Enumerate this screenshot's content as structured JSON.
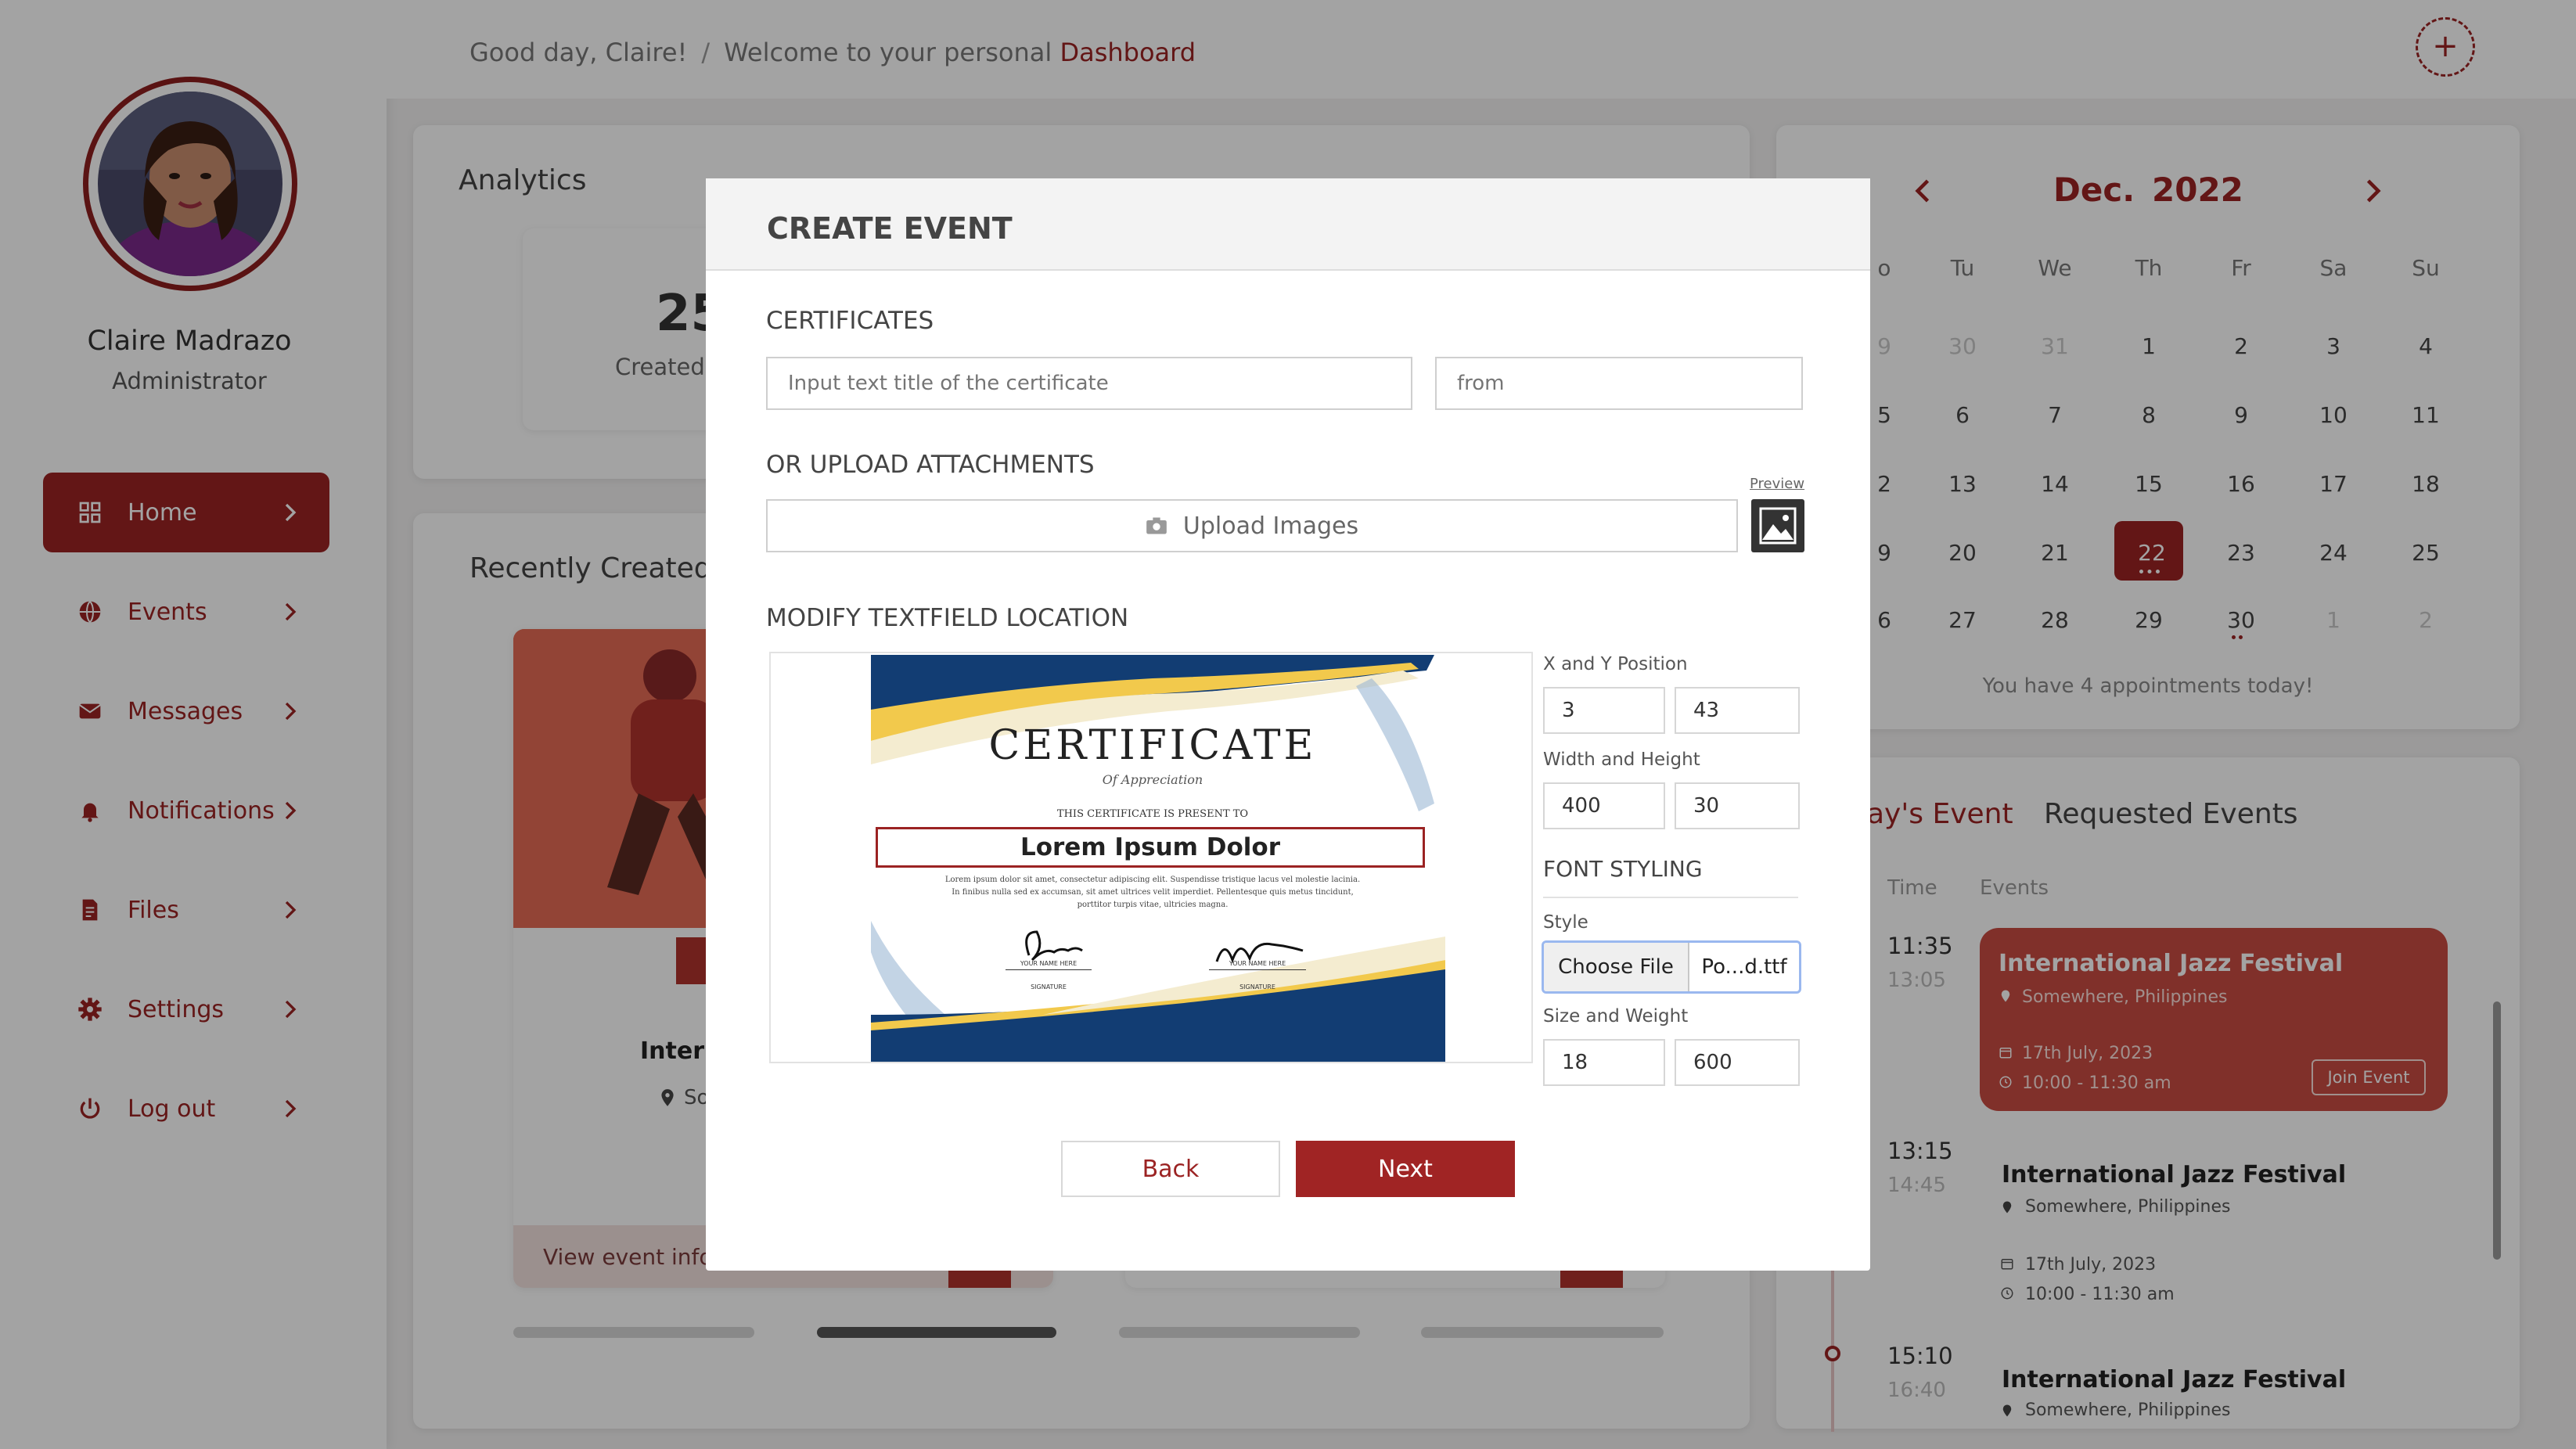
{
  "sidebar": {
    "user_name": "Claire Madrazo",
    "user_role": "Administrator",
    "items": [
      {
        "label": "Home",
        "icon": "grid-icon"
      },
      {
        "label": "Events",
        "icon": "globe-icon"
      },
      {
        "label": "Messages",
        "icon": "envelope-icon"
      },
      {
        "label": "Notifications",
        "icon": "bell-icon"
      },
      {
        "label": "Files",
        "icon": "file-icon"
      },
      {
        "label": "Settings",
        "icon": "gear-icon"
      },
      {
        "label": "Log out",
        "icon": "power-icon"
      }
    ]
  },
  "header": {
    "greeting": "Good day, Claire!",
    "separator": "/",
    "welcome": "Welcome to your personal",
    "highlight": "Dashboard",
    "add_symbol": "+"
  },
  "analytics": {
    "title": "Analytics",
    "stat_value": "25",
    "stat_label": "Created"
  },
  "recent": {
    "title": "Recently Created",
    "card_name": "Intern",
    "card_location_short": "So",
    "card_link": "View event inform"
  },
  "calendar": {
    "month": "Dec.",
    "year": "2022",
    "weekdays": [
      "o",
      "Tu",
      "We",
      "Th",
      "Fr",
      "Sa",
      "Su"
    ],
    "weeks": [
      [
        "9",
        "30",
        "31",
        "1",
        "2",
        "3",
        "4"
      ],
      [
        "5",
        "6",
        "7",
        "8",
        "9",
        "10",
        "11"
      ],
      [
        "2",
        "13",
        "14",
        "15",
        "16",
        "17",
        "18"
      ],
      [
        "9",
        "20",
        "21",
        "22",
        "23",
        "24",
        "25"
      ],
      [
        "6",
        "27",
        "28",
        "29",
        "30",
        "1",
        "2"
      ]
    ],
    "today": "22",
    "appointments": "You have 4 appointments today!"
  },
  "events_panel": {
    "tab_today": "ay's Event",
    "tab_requested": "Requested Events",
    "col_time": "Time",
    "col_events": "Events",
    "items": [
      {
        "start": "11:35",
        "end": "13:05",
        "title": "International Jazz Festival",
        "location": "Somewhere, Philippines",
        "date": "17th July, 2023",
        "time": "10:00 - 11:30 am",
        "action": "Join Event"
      },
      {
        "start": "13:15",
        "end": "14:45",
        "title": "International Jazz Festival",
        "location": "Somewhere, Philippines",
        "date": "17th July, 2023",
        "time": "10:00 - 11:30 am"
      },
      {
        "start": "15:10",
        "end": "16:40",
        "title": "International Jazz Festival",
        "location": "Somewhere, Philippines"
      }
    ]
  },
  "modal": {
    "title": "CREATE EVENT",
    "certificates_label": "CERTIFICATES",
    "title_placeholder": "Input text title of the certificate",
    "from_placeholder": "from",
    "upload_section": "OR UPLOAD ATTACHMENTS",
    "upload_button": "Upload Images",
    "preview_label": "Preview",
    "modify_section": "MODIFY TEXTFIELD LOCATION",
    "certificate": {
      "heading": "CERTIFICATE",
      "subheading": "Of Appreciation",
      "present_line": "THIS CERTIFICATE IS PRESENT TO",
      "name": "Lorem Ipsum Dolor",
      "body_1": "Lorem ipsum dolor sit amet, consectetur adipiscing elit. Suspendisse tristique lacus vel molestie lacinia.",
      "body_2": "In finibus nulla sed ex accumsan, sit amet ultrices velit imperdiet. Pellentesque quis metus tincidunt,",
      "body_3": "porttitor turpis vitae, ultricies magna.",
      "sig_name": "YOUR NAME HERE",
      "sig_label": "SIGNATURE"
    },
    "xy_label": "X and Y Position",
    "x_value": "3",
    "y_value": "43",
    "wh_label": "Width and Height",
    "width_value": "400",
    "height_value": "30",
    "font_section": "FONT STYLING",
    "style_label": "Style",
    "choose_file": "Choose File",
    "file_name": "Po...d.ttf",
    "size_weight_label": "Size and Weight",
    "size_value": "18",
    "weight_value": "600",
    "back_button": "Back",
    "next_button": "Next"
  },
  "colors": {
    "brand": "#9b2323",
    "accent_card": "#c94c43",
    "overlay": "rgba(0,0,0,0.36)"
  }
}
